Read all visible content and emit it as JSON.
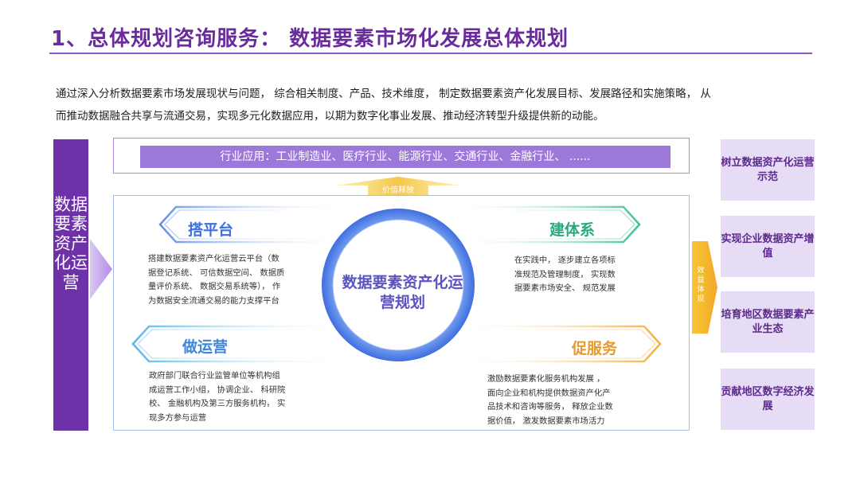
{
  "header": {
    "title": "1、总体规划咨询服务：   数据要素市场化发展总体规划"
  },
  "intro": {
    "line1": "通过深入分析数据要素市场发展现状与问题，  综合相关制度、产品、技术维度，  制定数据要素资产化发展目标、发展路径和实施策略，  从",
    "line2": "而推动数据融合共享与流通交易，实现多元化数据应用，以期为数字化事业发展、推动经济转型升级提供新的动能。"
  },
  "left_bar": {
    "label": "数据要素资产化运营"
  },
  "top_bar": {
    "label": "行业应用：工业制造业、医疗行业、能源行业、交通行业、金融行业、   ......"
  },
  "up_arrow": {
    "label": "价值释放"
  },
  "center": {
    "label": "数据要素资产化运营规划"
  },
  "quadrants": {
    "top_left": {
      "title": "搭平台",
      "lines": [
        "搭建数据要素资产化运营云平台（数",
        "据登记系统、 可信数据空间、 数据质",
        "量评价系统、 数据交易系统等）， 作",
        "为数据安全流通交易的能力支撑平台"
      ]
    },
    "top_right": {
      "title": "建体系",
      "lines": [
        "在实践中， 逐步建立各项标",
        "准规范及管理制度， 实现数",
        "据要素市场安全、 规范发展"
      ]
    },
    "bottom_left": {
      "title": "做运营",
      "lines": [
        "政府部门联合行业监管单位等机构组",
        "成运营工作小组， 协调企业、 科研院",
        "校、 金融机构及第三方服务机构， 实",
        "现多方参与运营"
      ]
    },
    "bottom_right": {
      "title": "促服务",
      "lines": [
        "激励数据要素化服务机构发展 ，",
        "面向企业和机构提供数据资产化产",
        "品技术和咨询等服务， 释放企业数",
        "据价值， 激发数据要素市场活力"
      ]
    }
  },
  "right_arrow": {
    "label": "效益体现"
  },
  "right_boxes": [
    {
      "label": "树立数据资产化运营示范"
    },
    {
      "label": "实现企业数据资产增值"
    },
    {
      "label": "培育地区数据要素产业生态"
    },
    {
      "label": "贡献地区数字经济发展"
    }
  ],
  "colors": {
    "brand_purple": "#6e31a8",
    "light_purple": "#9c78d8",
    "blue": "#3f6ee0",
    "green": "#3bbf95",
    "orange": "#e69a2e",
    "gold": "#f2c12e"
  }
}
